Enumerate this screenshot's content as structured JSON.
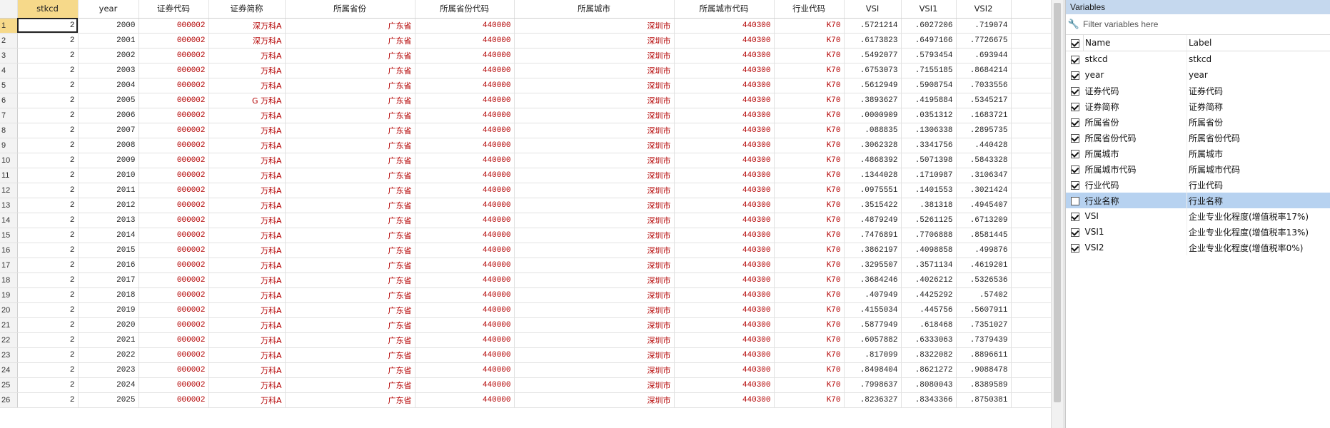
{
  "grid": {
    "columns": [
      "stkcd",
      "year",
      "证券代码",
      "证券简称",
      "所属省份",
      "所属省份代码",
      "所属城市",
      "所属城市代码",
      "行业代码",
      "VSI",
      "VSI1",
      "VSI2"
    ],
    "rows": [
      [
        "1",
        "2",
        "2000",
        "000002",
        "深万科A",
        "广东省",
        "440000",
        "深圳市",
        "440300",
        "K70",
        ".5721214",
        ".6027206",
        ".719074"
      ],
      [
        "2",
        "2",
        "2001",
        "000002",
        "深万科A",
        "广东省",
        "440000",
        "深圳市",
        "440300",
        "K70",
        ".6173823",
        ".6497166",
        ".7726675"
      ],
      [
        "3",
        "2",
        "2002",
        "000002",
        "万科A",
        "广东省",
        "440000",
        "深圳市",
        "440300",
        "K70",
        ".5492077",
        ".5793454",
        ".693944"
      ],
      [
        "4",
        "2",
        "2003",
        "000002",
        "万科A",
        "广东省",
        "440000",
        "深圳市",
        "440300",
        "K70",
        ".6753073",
        ".7155185",
        ".8684214"
      ],
      [
        "5",
        "2",
        "2004",
        "000002",
        "万科A",
        "广东省",
        "440000",
        "深圳市",
        "440300",
        "K70",
        ".5612949",
        ".5908754",
        ".7033556"
      ],
      [
        "6",
        "2",
        "2005",
        "000002",
        "G 万科A",
        "广东省",
        "440000",
        "深圳市",
        "440300",
        "K70",
        ".3893627",
        ".4195884",
        ".5345217"
      ],
      [
        "7",
        "2",
        "2006",
        "000002",
        "万科A",
        "广东省",
        "440000",
        "深圳市",
        "440300",
        "K70",
        ".0000909",
        ".0351312",
        ".1683721"
      ],
      [
        "8",
        "2",
        "2007",
        "000002",
        "万科A",
        "广东省",
        "440000",
        "深圳市",
        "440300",
        "K70",
        ".088835",
        ".1306338",
        ".2895735"
      ],
      [
        "9",
        "2",
        "2008",
        "000002",
        "万科A",
        "广东省",
        "440000",
        "深圳市",
        "440300",
        "K70",
        ".3062328",
        ".3341756",
        ".440428"
      ],
      [
        "10",
        "2",
        "2009",
        "000002",
        "万科A",
        "广东省",
        "440000",
        "深圳市",
        "440300",
        "K70",
        ".4868392",
        ".5071398",
        ".5843328"
      ],
      [
        "11",
        "2",
        "2010",
        "000002",
        "万科A",
        "广东省",
        "440000",
        "深圳市",
        "440300",
        "K70",
        ".1344028",
        ".1710987",
        ".3106347"
      ],
      [
        "12",
        "2",
        "2011",
        "000002",
        "万科A",
        "广东省",
        "440000",
        "深圳市",
        "440300",
        "K70",
        ".0975551",
        ".1401553",
        ".3021424"
      ],
      [
        "13",
        "2",
        "2012",
        "000002",
        "万科A",
        "广东省",
        "440000",
        "深圳市",
        "440300",
        "K70",
        ".3515422",
        ".381318",
        ".4945407"
      ],
      [
        "14",
        "2",
        "2013",
        "000002",
        "万科A",
        "广东省",
        "440000",
        "深圳市",
        "440300",
        "K70",
        ".4879249",
        ".5261125",
        ".6713209"
      ],
      [
        "15",
        "2",
        "2014",
        "000002",
        "万科A",
        "广东省",
        "440000",
        "深圳市",
        "440300",
        "K70",
        ".7476891",
        ".7706888",
        ".8581445"
      ],
      [
        "16",
        "2",
        "2015",
        "000002",
        "万科A",
        "广东省",
        "440000",
        "深圳市",
        "440300",
        "K70",
        ".3862197",
        ".4098858",
        ".499876"
      ],
      [
        "17",
        "2",
        "2016",
        "000002",
        "万科A",
        "广东省",
        "440000",
        "深圳市",
        "440300",
        "K70",
        ".3295507",
        ".3571134",
        ".4619201"
      ],
      [
        "18",
        "2",
        "2017",
        "000002",
        "万科A",
        "广东省",
        "440000",
        "深圳市",
        "440300",
        "K70",
        ".3684246",
        ".4026212",
        ".5326536"
      ],
      [
        "19",
        "2",
        "2018",
        "000002",
        "万科A",
        "广东省",
        "440000",
        "深圳市",
        "440300",
        "K70",
        ".407949",
        ".4425292",
        ".57402"
      ],
      [
        "20",
        "2",
        "2019",
        "000002",
        "万科A",
        "广东省",
        "440000",
        "深圳市",
        "440300",
        "K70",
        ".4155034",
        ".445756",
        ".5607911"
      ],
      [
        "21",
        "2",
        "2020",
        "000002",
        "万科A",
        "广东省",
        "440000",
        "深圳市",
        "440300",
        "K70",
        ".5877949",
        ".618468",
        ".7351027"
      ],
      [
        "22",
        "2",
        "2021",
        "000002",
        "万科A",
        "广东省",
        "440000",
        "深圳市",
        "440300",
        "K70",
        ".6057882",
        ".6333063",
        ".7379439"
      ],
      [
        "23",
        "2",
        "2022",
        "000002",
        "万科A",
        "广东省",
        "440000",
        "深圳市",
        "440300",
        "K70",
        ".817099",
        ".8322082",
        ".8896611"
      ],
      [
        "24",
        "2",
        "2023",
        "000002",
        "万科A",
        "广东省",
        "440000",
        "深圳市",
        "440300",
        "K70",
        ".8498404",
        ".8621272",
        ".9088478"
      ],
      [
        "25",
        "2",
        "2024",
        "000002",
        "万科A",
        "广东省",
        "440000",
        "深圳市",
        "440300",
        "K70",
        ".7998637",
        ".8080043",
        ".8389589"
      ],
      [
        "26",
        "2",
        "2025",
        "000002",
        "万科A",
        "广东省",
        "440000",
        "深圳市",
        "440300",
        "K70",
        ".8236327",
        ".8343366",
        ".8750381"
      ]
    ]
  },
  "variables": {
    "title": "Variables",
    "filter_placeholder": "Filter variables here",
    "header_name": "Name",
    "header_label": "Label",
    "items": [
      {
        "name": "stkcd",
        "label": "stkcd",
        "checked": true
      },
      {
        "name": "year",
        "label": "year",
        "checked": true
      },
      {
        "name": "证券代码",
        "label": "证券代码",
        "checked": true
      },
      {
        "name": "证券简称",
        "label": "证券简称",
        "checked": true
      },
      {
        "name": "所属省份",
        "label": "所属省份",
        "checked": true
      },
      {
        "name": "所属省份代码",
        "label": "所属省份代码",
        "checked": true
      },
      {
        "name": "所属城市",
        "label": "所属城市",
        "checked": true
      },
      {
        "name": "所属城市代码",
        "label": "所属城市代码",
        "checked": true
      },
      {
        "name": "行业代码",
        "label": "行业代码",
        "checked": true
      },
      {
        "name": "行业名称",
        "label": "行业名称",
        "checked": false,
        "highlight": true
      },
      {
        "name": "VSI",
        "label": "企业专业化程度(增值税率17%)",
        "checked": true
      },
      {
        "name": "VSI1",
        "label": "企业专业化程度(增值税率13%)",
        "checked": true
      },
      {
        "name": "VSI2",
        "label": "企业专业化程度(增值税率0%)",
        "checked": true
      }
    ]
  },
  "colors": {
    "string_text": "#b30000",
    "selected_header": "#f6d98a",
    "panel_title": "#c5d8ee",
    "highlight_row": "#b7d2f0"
  }
}
